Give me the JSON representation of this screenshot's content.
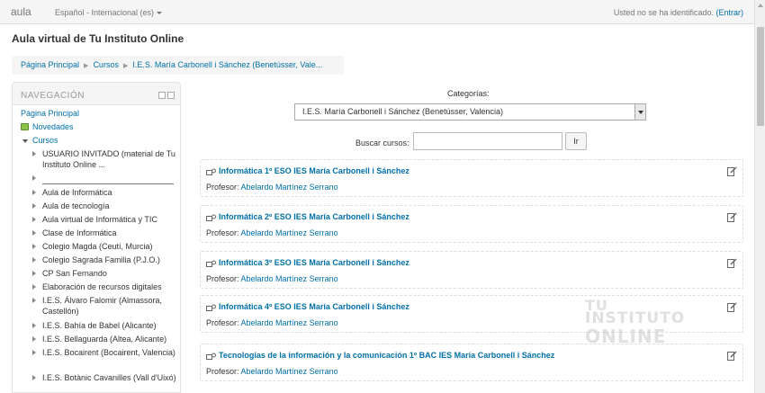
{
  "navbar": {
    "brand": "aula",
    "language": "Español - Internacional (es)",
    "login_text": "Usted no se ha identificado.",
    "login_link": "(Entrar)"
  },
  "header": {
    "title": "Aula virtual de Tu Instituto Online"
  },
  "breadcrumb": {
    "items": [
      "Página Principal",
      "Cursos",
      "I.E.S. María Carbonell i Sánchez (Benetússer, Vale..."
    ]
  },
  "navigation": {
    "title": "NAVEGACIÓN",
    "home": "Página Principal",
    "news": "Novedades",
    "courses": "Cursos",
    "tree": [
      "USUARIO INVITADO (material de Tu Instituto Online ...",
      "",
      "Aula de Informática",
      "Aula de tecnología",
      "Aula virtual de Informática y TIC",
      "Clase de Informática",
      "Colegio Magda (Ceutí, Murcia)",
      "Colegio Sagrada Familia (P.J.O.)",
      "CP San Fernando",
      "Elaboración de recursos digitales",
      "I.E.S. Álvaro Falomir (Almassora, Castellón)",
      "I.E.S. Bahía de Babel (Alicante)",
      "I.E.S. Bellaguarda (Altea, Alicante)",
      "I.E.S. Bocairent (Bocairent, Valencia)",
      "I.E.S. Botànic Cavanilles (Vall d'Uixó)"
    ]
  },
  "categories": {
    "label": "Categorías:",
    "selected": "I.E.S. María Carbonell i Sánchez (Benetússer, Valencia)"
  },
  "search": {
    "label": "Buscar cursos:",
    "value": "",
    "button": "Ir"
  },
  "courses": [
    {
      "title": "Informática 1º ESO IES María Carbonell i Sánchez",
      "teacher_label": "Profesor:",
      "teacher": "Abelardo Martínez Serrano"
    },
    {
      "title": "Informática 2º ESO IES María Carbonell i Sánchez",
      "teacher_label": "Profesor:",
      "teacher": "Abelardo Martínez Serrano"
    },
    {
      "title": "Informática 3º ESO IES María Carbonell i Sánchez",
      "teacher_label": "Profesor:",
      "teacher": "Abelardo Martínez Serrano"
    },
    {
      "title": "Informática 4º ESO IES María Carbonell i Sánchez",
      "teacher_label": "Profesor:",
      "teacher": "Abelardo Martínez Serrano"
    },
    {
      "title": "Tecnologías de la información y la comunicación 1º BAC IES María Carbonell i Sánchez",
      "teacher_label": "Profesor:",
      "teacher": "Abelardo Martínez Serrano"
    }
  ],
  "watermark": {
    "line1": "TU",
    "line2": "INSTITUTO",
    "line3": "ONLINE"
  },
  "colors": {
    "link": "#0070a8",
    "navbar_bg": "#f5f5f5"
  }
}
